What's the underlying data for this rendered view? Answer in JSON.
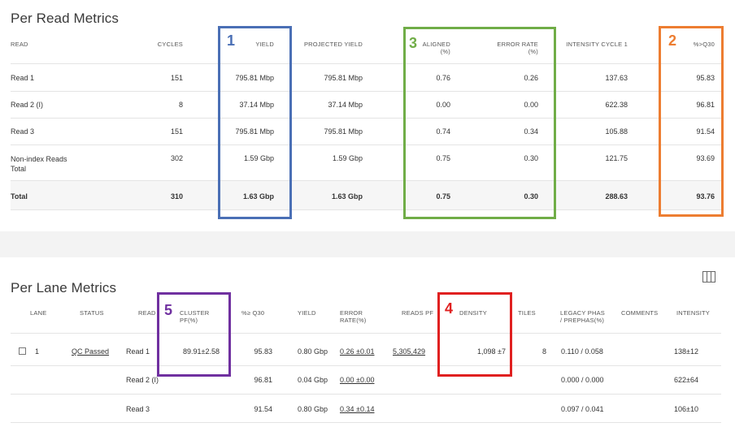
{
  "read": {
    "title": "Per Read Metrics",
    "headers": {
      "read": "READ",
      "cycles": "CYCLES",
      "yield": "YIELD",
      "projected": "PROJECTED YIELD",
      "aligned": "ALIGNED",
      "aligned_unit": "(%)",
      "error": "ERROR RATE",
      "error_unit": "(%)",
      "intensity": "INTENSITY CYCLE 1",
      "q30": "%>Q30"
    },
    "rows": [
      {
        "read": "Read 1",
        "cycles": "151",
        "yield": "795.81 Mbp",
        "projected": "795.81 Mbp",
        "aligned": "0.76",
        "error": "0.26",
        "intensity": "137.63",
        "q30": "95.83"
      },
      {
        "read": "Read 2 (I)",
        "cycles": "8",
        "yield": "37.14 Mbp",
        "projected": "37.14 Mbp",
        "aligned": "0.00",
        "error": "0.00",
        "intensity": "622.38",
        "q30": "96.81"
      },
      {
        "read": "Read 3",
        "cycles": "151",
        "yield": "795.81 Mbp",
        "projected": "795.81 Mbp",
        "aligned": "0.74",
        "error": "0.34",
        "intensity": "105.88",
        "q30": "91.54"
      },
      {
        "read": "Non-index Reads",
        "read2": "Total",
        "cycles": "302",
        "yield": "1.59 Gbp",
        "projected": "1.59 Gbp",
        "aligned": "0.75",
        "error": "0.30",
        "intensity": "121.75",
        "q30": "93.69"
      },
      {
        "read": "Total",
        "cycles": "310",
        "yield": "1.63 Gbp",
        "projected": "1.63 Gbp",
        "aligned": "0.75",
        "error": "0.30",
        "intensity": "288.63",
        "q30": "93.76"
      }
    ]
  },
  "lane": {
    "title": "Per Lane Metrics",
    "headers": {
      "lane": "LANE",
      "status": "STATUS",
      "read": "READ",
      "cluster": "CLUSTER",
      "cluster2": "PF(%)",
      "q30": "%≥ Q30",
      "yield": "YIELD",
      "error": "ERROR",
      "error2": "RATE(%)",
      "readspf": "READS PF",
      "density": "DENSITY",
      "tiles": "TILES",
      "legacy": "LEGACY PHAS",
      "legacy2": "/ PREPHAS(%)",
      "comments": "COMMENTS",
      "intensity": "INTENSITY"
    },
    "rows": [
      {
        "lane": "1",
        "status": "QC Passed",
        "read": "Read 1",
        "cluster": "89.91±2.58",
        "q30": "95.83",
        "yield": "0.80 Gbp",
        "error": "0.26 ±0.01",
        "readspf": "5,305,429",
        "density": "1,098 ±7",
        "tiles": "8",
        "legacy": "0.110 / 0.058",
        "intensity": "138±12"
      },
      {
        "read": "Read 2 (I)",
        "q30": "96.81",
        "yield": "0.04 Gbp",
        "error": "0.00 ±0.00",
        "legacy": "0.000 / 0.000",
        "intensity": "622±64"
      },
      {
        "read": "Read 3",
        "q30": "91.54",
        "yield": "0.80 Gbp",
        "error": "0.34 ±0.14",
        "legacy": "0.097 / 0.041",
        "intensity": "106±10"
      }
    ]
  },
  "annotations": {
    "box1": "1",
    "box2": "2",
    "box3": "3",
    "box4": "4",
    "box5": "5",
    "colors": {
      "box1": "#4a6fb5",
      "box2": "#ed7d31",
      "box3": "#70ad47",
      "box4": "#e02020",
      "box5": "#7030a0"
    }
  }
}
